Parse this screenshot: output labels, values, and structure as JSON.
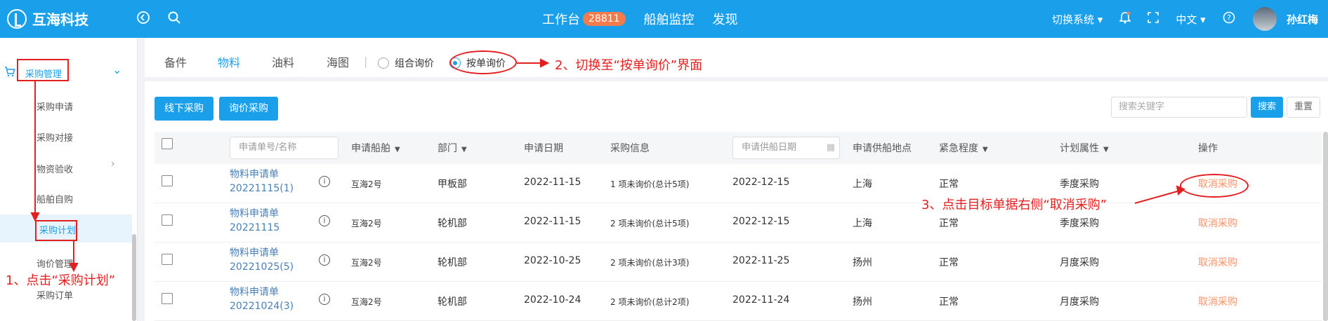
{
  "header": {
    "app_name": "互海科技",
    "nav": [
      {
        "label": "工作台",
        "badge": "28811"
      },
      {
        "label": "船舶监控"
      },
      {
        "label": "发现"
      }
    ],
    "switch_system": "切换系统",
    "language": "中文",
    "user_name": "孙红梅"
  },
  "sidebar": {
    "group": "采购管理",
    "items": [
      {
        "label": "采购申请"
      },
      {
        "label": "采购对接"
      },
      {
        "label": "物资验收"
      },
      {
        "label": "船舶自购"
      },
      {
        "label": "采购计划"
      },
      {
        "label": "询价管理"
      },
      {
        "label": "采购订单"
      }
    ]
  },
  "tabs": [
    "备件",
    "物料",
    "油料",
    "海图"
  ],
  "active_tab": "物料",
  "radios": [
    {
      "label": "组合询价",
      "checked": false
    },
    {
      "label": "按单询价",
      "checked": true
    }
  ],
  "toolbar": {
    "offline_button": "线下采购",
    "inquiry_button": "询价采购",
    "search_placeholder": "搜索关键字",
    "search_button": "搜索",
    "reset_button": "重置"
  },
  "table": {
    "filter_placeholder": "申请单号/名称",
    "columns": {
      "vessel": "申请船舶",
      "dept": "部门",
      "date": "申请日期",
      "info": "采购信息",
      "supply_date": "申请供船日期",
      "place": "申请供船地点",
      "urgency": "紧急程度",
      "plan": "计划属性",
      "action": "操作"
    },
    "rows": [
      {
        "request": "物料申请单20221115(1)",
        "vessel": "互海2号",
        "dept": "甲板部",
        "date": "2022-11-15",
        "info": "1 项未询价(总计5项)",
        "supply_date": "2022-12-15",
        "place": "上海",
        "urgency": "正常",
        "plan": "季度采购",
        "action": "取消采购"
      },
      {
        "request": "物料申请单20221115",
        "vessel": "互海2号",
        "dept": "轮机部",
        "date": "2022-11-15",
        "info": "2 项未询价(总计5项)",
        "supply_date": "2022-12-15",
        "place": "上海",
        "urgency": "正常",
        "plan": "季度采购",
        "action": "取消采购"
      },
      {
        "request": "物料申请单20221025(5)",
        "vessel": "互海2号",
        "dept": "轮机部",
        "date": "2022-10-25",
        "info": "2 项未询价(总计3项)",
        "supply_date": "2022-11-25",
        "place": "扬州",
        "urgency": "正常",
        "plan": "月度采购",
        "action": "取消采购"
      },
      {
        "request": "物料申请单20221024(3)",
        "vessel": "互海2号",
        "dept": "轮机部",
        "date": "2022-10-24",
        "info": "2 项未询价(总计2项)",
        "supply_date": "2022-11-24",
        "place": "扬州",
        "urgency": "正常",
        "plan": "月度采购",
        "action": "取消采购"
      }
    ]
  },
  "annotations": {
    "step1": "1、点击“采购计划”",
    "step2": "2、切换至“按单询价”界面",
    "step3": "3、点击目标单据右侧“取消采购”"
  },
  "colors": {
    "primary": "#1aa0eb",
    "annotation": "#e41e1e",
    "cancel": "#f4926b"
  }
}
